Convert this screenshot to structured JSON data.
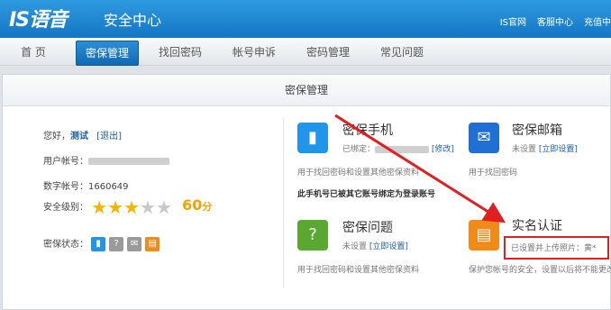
{
  "header": {
    "logo": "IS语音",
    "title": "安全中心",
    "links": [
      "IS官网",
      "客服中心",
      "充值中"
    ]
  },
  "nav": {
    "tabs": [
      {
        "label": "首 页",
        "active": false
      },
      {
        "label": "密保管理",
        "active": true
      },
      {
        "label": "找回密码",
        "active": false
      },
      {
        "label": "帐号申诉",
        "active": false
      },
      {
        "label": "密码管理",
        "active": false
      },
      {
        "label": "常见问题",
        "active": false
      }
    ]
  },
  "panel": {
    "title": "密保管理"
  },
  "account": {
    "greeting": "您好，",
    "nickname": "测试",
    "logout": "[退出]",
    "user_label": "用户帐号：",
    "number_label": "数字帐号：",
    "number": "1660649",
    "level_label": "安全级别：",
    "stars": 3,
    "stars_total": 5,
    "score": "60",
    "score_unit": "分",
    "status_label": "密保状态："
  },
  "cards": {
    "phone": {
      "icon": "phone-icon",
      "title": "密保手机",
      "status": "已绑定：",
      "action": "[修改]",
      "desc": "用于找回密码和设置其他密保资料",
      "note": "此手机号已被其它账号绑定为登录账号"
    },
    "email": {
      "icon": "mail-icon",
      "title": "密保邮箱",
      "status": "未设置",
      "action": "[立即设置]",
      "desc": "用于找回密码"
    },
    "question": {
      "icon": "question-icon",
      "title": "密保问题",
      "status": "未设置",
      "action": "[立即设置]",
      "desc": "用于找回密码和设置其他密保资料"
    },
    "realname": {
      "icon": "id-card-icon",
      "title": "实名认证",
      "status": "已设置并上传照片：黄*",
      "desc": "保护您帐号的安全，设置以后将不能更改"
    }
  },
  "colors": {
    "header_blue": "#1a7fd0",
    "phone_icon": "#2196e8",
    "email_icon": "#1f6fd4",
    "question_icon": "#5aa830",
    "realname_icon": "#f08a18",
    "arrow_red": "#e02020",
    "score_orange": "#f5a300"
  }
}
